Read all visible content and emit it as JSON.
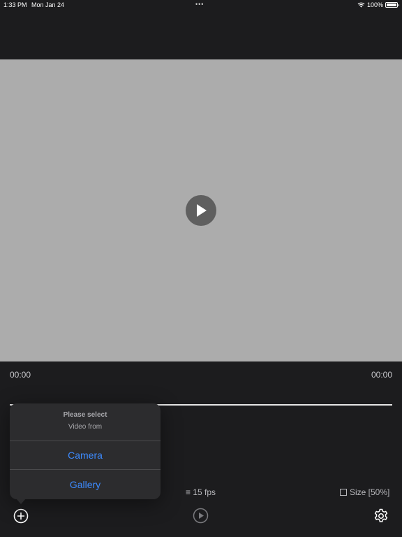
{
  "status_bar": {
    "time": "1:33 PM",
    "date": "Mon Jan 24",
    "dots": "•••",
    "battery": "100%"
  },
  "player": {
    "current_time": "00:00",
    "total_time": "00:00"
  },
  "popover": {
    "title": "Please select",
    "subtitle": "Video from",
    "options": [
      "Camera",
      "Gallery"
    ]
  },
  "controls": {
    "fps_icon": "≡",
    "fps": "15 fps",
    "size_label": "Size [50%]"
  },
  "icons": {
    "add": "plus-circle-icon",
    "play": "play-circle-icon",
    "settings": "gear-icon"
  },
  "colors": {
    "background": "#1c1c1e",
    "video_placeholder": "#acacac",
    "accent": "#3d8bff"
  }
}
